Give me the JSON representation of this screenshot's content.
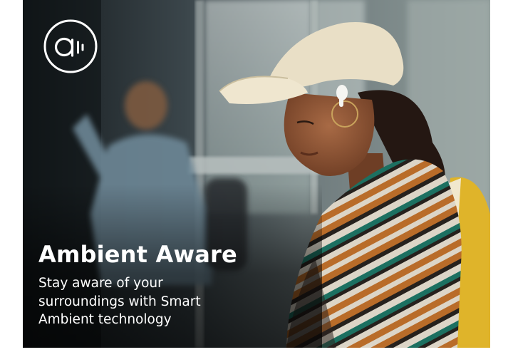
{
  "banner": {
    "title": "Ambient Aware",
    "description_lines": [
      "Stay aware of your",
      "surroundings with Smart",
      "Ambient technology"
    ],
    "logo_icon": "ambient-sound-icon",
    "text_color": "#ffffff"
  }
}
